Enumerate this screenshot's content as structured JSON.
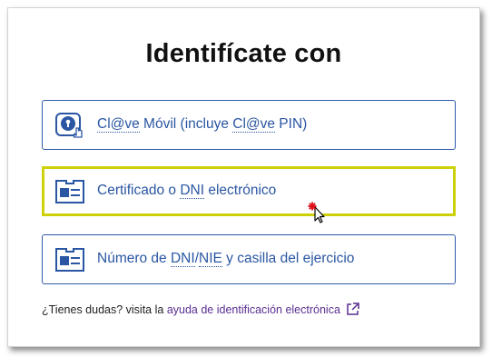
{
  "title": "Identifícate con",
  "options": [
    {
      "icon": "clave-movil-icon",
      "label_prefix": "Cl@ve",
      "label_middle": " Móvil (incluye ",
      "label_abbr": "Cl@ve",
      "label_suffix": " PIN)"
    },
    {
      "icon": "id-card-icon",
      "label_prefix": "Certificado o ",
      "label_abbr": "DNI",
      "label_suffix": " electrónico",
      "selected": true
    },
    {
      "icon": "id-card-icon",
      "label_prefix": "Número de ",
      "label_abbr": "DNI",
      "label_sep": "/",
      "label_abbr2": "NIE",
      "label_suffix": " y casilla del ejercicio"
    }
  ],
  "help": {
    "text": "¿Tienes dudas? visita la ",
    "link": "ayuda de identificación electrónica",
    "link_icon": "external-link-icon"
  },
  "colors": {
    "accent": "#2a56a3",
    "border": "#2f5aa7",
    "highlight": "#cdd10a",
    "link": "#5a2f91",
    "cursor_marker": "#e0141e"
  }
}
